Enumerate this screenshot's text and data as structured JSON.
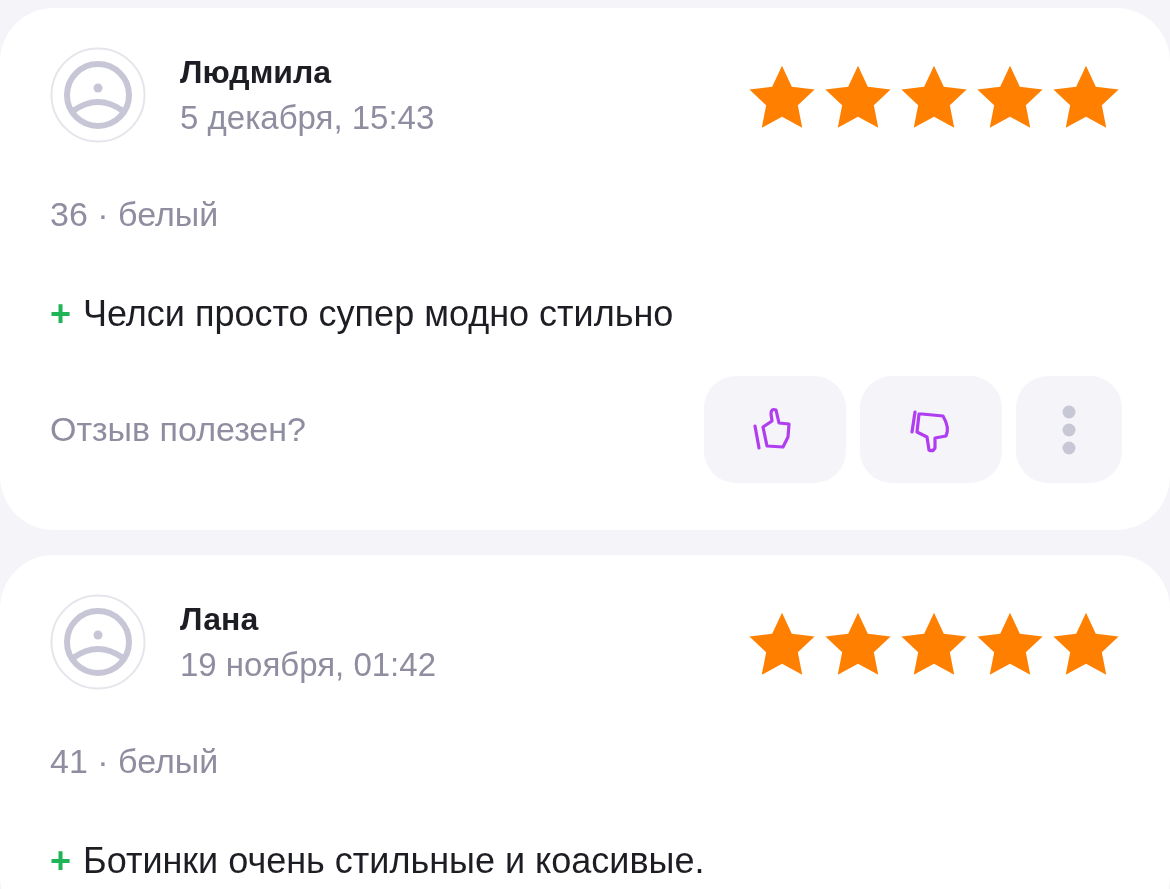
{
  "reviews": [
    {
      "author": "Людмила",
      "date": "5 декабря, 15:43",
      "stars": 5,
      "variant": "36 · белый",
      "pros_mark": "+",
      "pros": "Челси просто супер модно стильно",
      "helpful_prompt": "Отзыв полезен?"
    },
    {
      "author": "Лана",
      "date": "19 ноября, 01:42",
      "stars": 5,
      "variant": "41 · белый",
      "pros_mark": "+",
      "pros": "Ботинки очень стильные и коасивые."
    }
  ]
}
